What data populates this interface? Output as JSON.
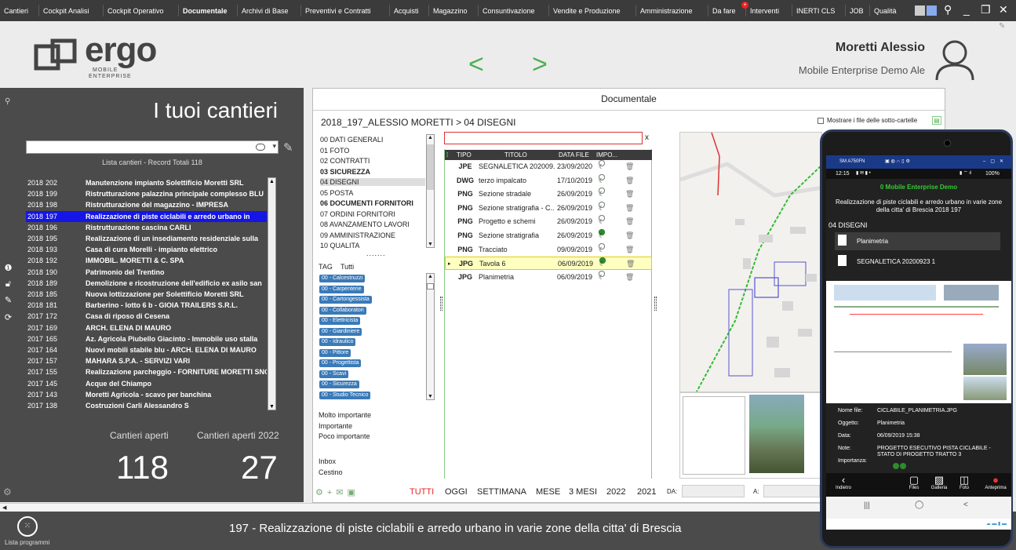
{
  "menu": [
    "Cantieri",
    "Cockpit Analisi",
    "Cockpit Operativo",
    "Documentale",
    "Archivi di Base",
    "Preventivi e Contratti",
    "Acquisti",
    "Magazzino",
    "Consuntivazione",
    "Vendite e Produzione",
    "Amministrazione",
    "Da fare",
    "Interventi",
    "INERTI CLS",
    "JOB",
    "Qualità"
  ],
  "menu_badge": "+",
  "logo": {
    "word": "ergo",
    "sub1": "MOBILE",
    "sub2": "ENTERPRISE"
  },
  "user": {
    "name": "Moretti Alessio",
    "subtitle": "Mobile Enterprise Demo Ale"
  },
  "left": {
    "title": "I tuoi cantieri",
    "list_info": "Lista cantieri - Record Totali 118",
    "rows": [
      [
        "2018",
        "202",
        "Manutenzione impianto Solettificio Moretti SRL"
      ],
      [
        "2018",
        "199",
        "Ristrutturazione palazzina principale complesso BLU"
      ],
      [
        "2018",
        "198",
        "Ristrutturazione del magazzino - IMPRESA"
      ],
      [
        "2018",
        "197",
        "Realizzazione di piste ciclabili e arredo urbano in"
      ],
      [
        "2018",
        "196",
        "Ristrutturazione cascina CARLI"
      ],
      [
        "2018",
        "195",
        "Realizzazione di un insediamento residenziale sulla"
      ],
      [
        "2018",
        "193",
        "Casa di cura Morelli - impianto elettrico"
      ],
      [
        "2018",
        "192",
        "IMMOBIL. MORETTI & C. SPA"
      ],
      [
        "2018",
        "190",
        "Patrimonio del Trentino"
      ],
      [
        "2018",
        "189",
        "Demolizione e ricostruzione dell'edificio ex asilo san"
      ],
      [
        "2018",
        "185",
        "Nuova lottizzazione per Solettificio Moretti SRL"
      ],
      [
        "2018",
        "181",
        "Barberino - lotto 6 b - GIOIA TRAILERS  S.R.L."
      ],
      [
        "2017",
        "172",
        "Casa di riposo di Cesena"
      ],
      [
        "2017",
        "169",
        "ARCH. ELENA DI MAURO"
      ],
      [
        "2017",
        "165",
        "Az. Agricola Piubello Giacinto - Immobile uso stalla"
      ],
      [
        "2017",
        "164",
        "Nuovi mobili stabile blu - ARCH. ELENA DI MAURO"
      ],
      [
        "2017",
        "157",
        "MAHARA S.P.A. - SERVIZI VARI"
      ],
      [
        "2017",
        "155",
        "Realizzazione parcheggio - FORNITURE MORETTI SNC"
      ],
      [
        "2017",
        "145",
        "Acque del Chiampo"
      ],
      [
        "2017",
        "143",
        "Moretti Agricola - scavo per banchina"
      ],
      [
        "2017",
        "138",
        "Costruzioni Carli Alessandro S"
      ]
    ],
    "selected_index": 3,
    "stat1_label": "Cantieri aperti",
    "stat1_value": "118",
    "stat2_label": "Cantieri aperti 2022",
    "stat2_value": "27"
  },
  "doc": {
    "title": "Documentale",
    "breadcrumb": "2018_197_ALESSIO MORETTI > 04 DISEGNI",
    "subfolders_label": "Mostrare i file delle sotto-cartelle",
    "clear": "x",
    "folders": [
      [
        "00 DATI GENERALI",
        false
      ],
      [
        "01 FOTO",
        false
      ],
      [
        "02 CONTRATTI",
        false
      ],
      [
        "03 SICUREZZA",
        true
      ],
      [
        "04 DISEGNI",
        false
      ],
      [
        "05 POSTA",
        false
      ],
      [
        "06 DOCUMENTI FORNITORI",
        true
      ],
      [
        "07 ORDINI FORNITORI",
        false
      ],
      [
        "08 AVANZAMENTO LAVORI",
        false
      ],
      [
        "09 AMMINISTRAZIONE",
        false
      ],
      [
        "10 QUALITA",
        false
      ]
    ],
    "tag_label": "TAG",
    "tag_all": "Tutti",
    "tags": [
      "00 - Calcestruzzi",
      "00 - Carpenterie",
      "00 - Cartongessista",
      "00 - Collaboratori",
      "00 - Elettricista",
      "00 - Giardiniere",
      "00 - Idraulico",
      "00 - Pittore",
      "00 - Progettista",
      "00 - Scavi",
      "00 - Sicurezza",
      "00 - Studio Tecnico"
    ],
    "importance": [
      "Molto importante",
      "Importante",
      "Poco importante"
    ],
    "inbox": "Inbox",
    "trash": "Cestino",
    "cols": [
      "TIPO",
      "TITOLO",
      "DATA FILE",
      "IMPO..."
    ],
    "files": [
      {
        "t": "JPE",
        "n": "SEGNALETICA 202009...",
        "d": "23/09/2020",
        "i": 0
      },
      {
        "t": "DWG",
        "n": "terzo impalcato",
        "d": "17/10/2019",
        "i": 2
      },
      {
        "t": "PNG",
        "n": "Sezione stradale",
        "d": "26/09/2019",
        "i": 2
      },
      {
        "t": "PNG",
        "n": "Sezione stratigrafia - C...",
        "d": "26/09/2019",
        "i": 2
      },
      {
        "t": "PNG",
        "n": "Progetto e schemi",
        "d": "26/09/2019",
        "i": 2
      },
      {
        "t": "PNG",
        "n": "Sezione stratigrafia",
        "d": "26/09/2019",
        "i": 3
      },
      {
        "t": "PNG",
        "n": "Tracciato",
        "d": "09/09/2019",
        "i": 2
      },
      {
        "t": "JPG",
        "n": "Tavola 6",
        "d": "06/09/2019",
        "i": 3
      },
      {
        "t": "JPG",
        "n": "Planimetria",
        "d": "06/09/2019",
        "i": 2
      }
    ],
    "selected_file": 7,
    "filters": [
      "TUTTI",
      "OGGI",
      "SETTIMANA",
      "MESE",
      "3 MESI",
      "2022",
      "2021"
    ],
    "da": "DA:",
    "a": "A:"
  },
  "footer": {
    "programs": "Lista programmi",
    "title": "197 - Realizzazione di piste ciclabili e arredo urbano in varie zone della citta' di Brescia"
  },
  "phone": {
    "model": "SM A750FN",
    "time": "12:15",
    "battery": "100%",
    "app_title": "0 Mobile Enterprise Demo",
    "project": "Realizzazione di piste ciclabili e arredo urbano in varie zone della citta' di Brescia 2018 197",
    "folder": "04 DISEGNI",
    "files": [
      "Planimetria",
      "SEGNALETICA 20200923 1"
    ],
    "labels": [
      "Nome file:",
      "Oggetto:",
      "Data:",
      "Note:",
      "Importanza:"
    ],
    "values": [
      "CICLABILE_PLANIMETRIA.JPG",
      "Planimetria",
      "06/09/2019 15:38",
      "PROGETTO ESECUTIVO PISTA CICLABILE - STATO DI PROGETTO TRATTO 3"
    ],
    "nav": [
      "Indietro",
      "Files",
      "Galleria",
      "Foto",
      "Anteprima"
    ]
  }
}
